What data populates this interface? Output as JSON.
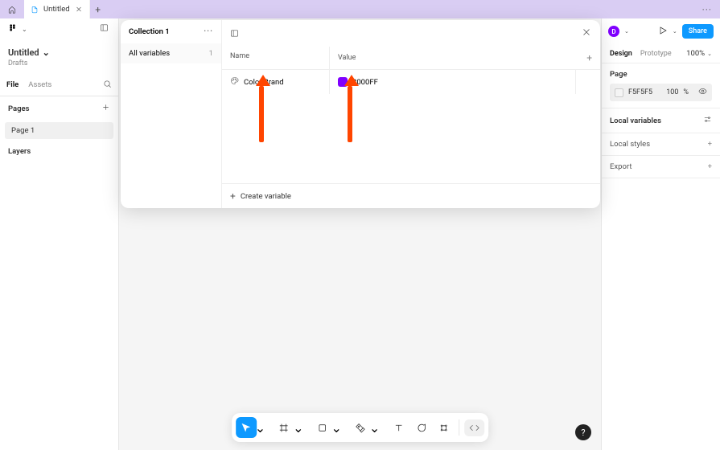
{
  "tabbar": {
    "active_tab_title": "Untitled",
    "menu_dots": "···"
  },
  "left_panel": {
    "doc_title": "Untitled",
    "doc_location": "Drafts",
    "tab_file": "File",
    "tab_assets": "Assets",
    "section_pages": "Pages",
    "pages": [
      "Page 1"
    ],
    "section_layers": "Layers"
  },
  "variables_panel": {
    "collection_name": "Collection 1",
    "group_all": "All variables",
    "group_count": "1",
    "col_name": "Name",
    "col_value": "Value",
    "rows": [
      {
        "name": "Color Brand",
        "value_hex": "8000FF",
        "swatch": "#8000ff"
      }
    ],
    "create_label": "Create variable"
  },
  "right_panel": {
    "avatar_initial": "D",
    "share_label": "Share",
    "tab_design": "Design",
    "tab_prototype": "Prototype",
    "zoom": "100%",
    "page_section": "Page",
    "page_color": "F5F5F5",
    "page_opacity": "100",
    "page_opacity_unit": "%",
    "local_variables": "Local variables",
    "local_styles": "Local styles",
    "export": "Export"
  },
  "help": "?"
}
